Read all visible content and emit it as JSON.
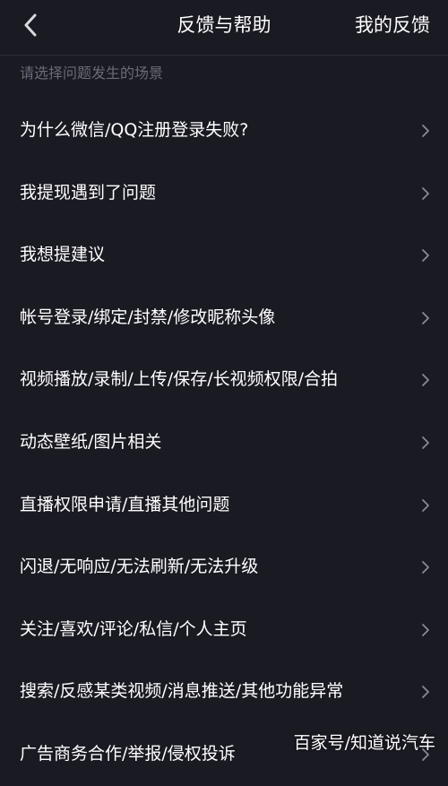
{
  "header": {
    "back_icon": "chevron-left-icon",
    "title": "反馈与帮助",
    "my_feedback_label": "我的反馈"
  },
  "section": {
    "label": "请选择问题发生的场景"
  },
  "items": [
    {
      "label": "为什么微信/QQ注册登录失败?"
    },
    {
      "label": "我提现遇到了问题"
    },
    {
      "label": "我想提建议"
    },
    {
      "label": "帐号登录/绑定/封禁/修改昵称头像"
    },
    {
      "label": "视频播放/录制/上传/保存/长视频权限/合拍"
    },
    {
      "label": "动态壁纸/图片相关"
    },
    {
      "label": "直播权限申请/直播其他问题"
    },
    {
      "label": "闪退/无响应/无法刷新/无法升级"
    },
    {
      "label": "关注/喜欢/评论/私信/个人主页"
    },
    {
      "label": "搜索/反感某类视频/消息推送/其他功能异常"
    },
    {
      "label": "广告商务合作/举报/侵权投诉"
    }
  ],
  "watermark": {
    "text": "百家号/知道说汽车"
  },
  "colors": {
    "background": "#1a1a23",
    "primary_text": "#ffffff",
    "secondary_text": "#6b6b78",
    "chevron": "#8a8a94",
    "divider": "#2c2c36"
  }
}
